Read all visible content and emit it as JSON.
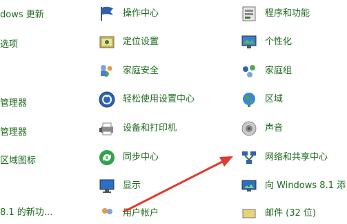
{
  "left_items": [
    {
      "label": "dows 更新"
    },
    {
      "label": "选项"
    },
    {
      "label": ""
    },
    {
      "label": "管理器"
    },
    {
      "label": "管理器"
    },
    {
      "label": "区域图标"
    },
    {
      "label": ""
    },
    {
      "label": "8.1 的新功..."
    }
  ],
  "mid_items": [
    {
      "label": "操作中心",
      "icon": "flag-icon"
    },
    {
      "label": "定位设置",
      "icon": "location-icon"
    },
    {
      "label": "家庭安全",
      "icon": "family-icon"
    },
    {
      "label": "轻松使用设置中心",
      "icon": "ease-of-access-icon"
    },
    {
      "label": "设备和打印机",
      "icon": "printer-icon"
    },
    {
      "label": "同步中心",
      "icon": "sync-icon"
    },
    {
      "label": "显示",
      "icon": "display-icon"
    },
    {
      "label": "用户帐户",
      "icon": "users-icon"
    }
  ],
  "right_items": [
    {
      "label": "程序和功能",
      "icon": "programs-icon"
    },
    {
      "label": "个性化",
      "icon": "personalize-icon"
    },
    {
      "label": "家庭组",
      "icon": "homegroup-icon"
    },
    {
      "label": "区域",
      "icon": "region-icon"
    },
    {
      "label": "声音",
      "icon": "sound-icon"
    },
    {
      "label": "网络和共享中心",
      "icon": "network-icon"
    },
    {
      "label": "向 Windows 8.1 添",
      "icon": "add-feature-icon"
    },
    {
      "label": "邮件 (32 位)",
      "icon": "mail-icon"
    }
  ],
  "colors": {
    "link": "#1e6b1e",
    "arrow": "#e03a2e"
  }
}
